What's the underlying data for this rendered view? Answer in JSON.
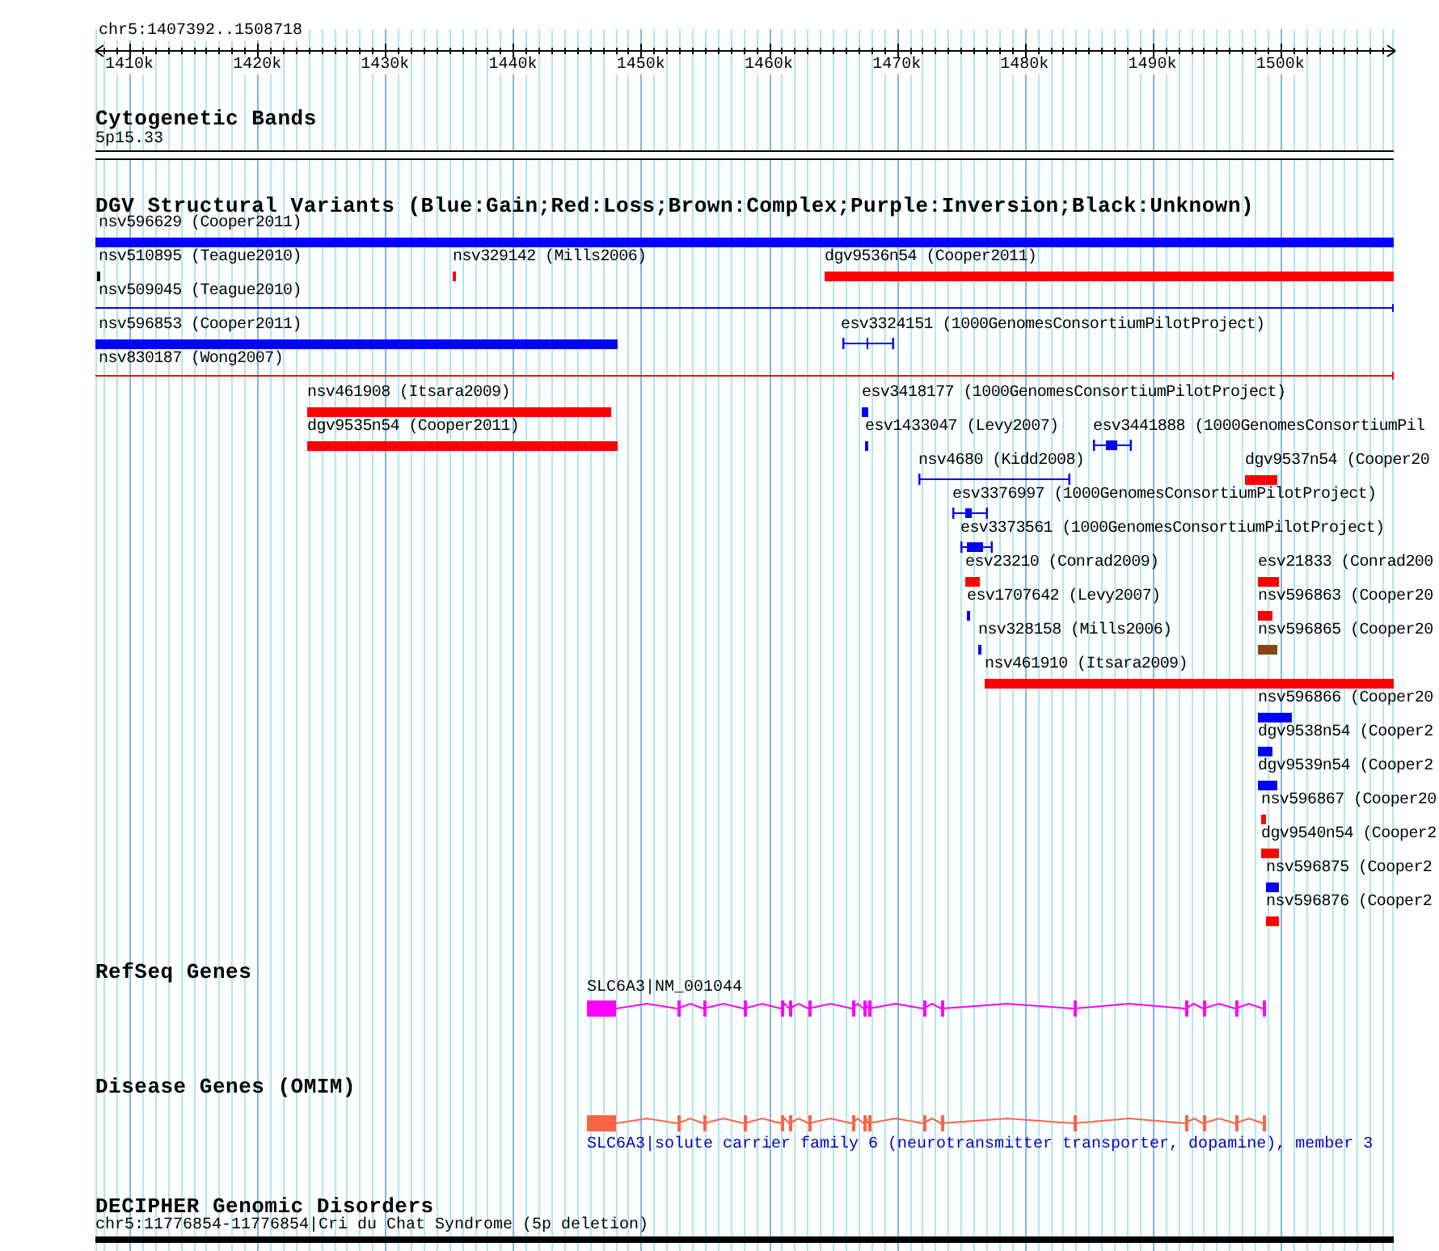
{
  "ruler": {
    "title": "chr5:1407392..1508718",
    "ticks": [
      "1410k",
      "1420k",
      "1430k",
      "1440k",
      "1450k",
      "1460k",
      "1470k",
      "1480k",
      "1490k",
      "1500k"
    ]
  },
  "tracks": [
    {
      "kind": "bands",
      "title": "Cytogenetic Bands",
      "features": [
        {
          "label": "5p15.33"
        }
      ]
    },
    {
      "kind": "variants",
      "title": "DGV Structural Variants (Blue:Gain;Red:Loss;Brown:Complex;Purple:Inversion;Black:Unknown)",
      "features": [
        {
          "kind": "bar",
          "label": "nsv596629 (Cooper2011)",
          "color": "#0000ff"
        },
        {
          "kind": "bar",
          "label": "nsv510895 (Teague2010)",
          "color": "#000000"
        },
        {
          "kind": "bar",
          "label": "nsv329142 (Mills2006)",
          "color": "#ff0000"
        },
        {
          "kind": "bar",
          "label": "dgv9536n54 (Cooper2011)",
          "color": "#ff0000"
        },
        {
          "kind": "line",
          "label": "nsv509045 (Teague2010)",
          "color": "#0000ff"
        },
        {
          "kind": "bar",
          "label": "nsv596853 (Cooper2011)",
          "color": "#0000ff"
        },
        {
          "kind": "span",
          "label": "esv3324151 (1000GenomesConsortiumPilotProject)",
          "color": "#0000ff"
        },
        {
          "kind": "line",
          "label": "nsv830187 (Wong2007)",
          "color": "#ff0000"
        },
        {
          "kind": "bar",
          "label": "nsv461908 (Itsara2009)",
          "color": "#ff0000"
        },
        {
          "kind": "bar",
          "label": "esv3418177 (1000GenomesConsortiumPilotProject)",
          "color": "#0000ff"
        },
        {
          "kind": "bar",
          "label": "dgv9535n54 (Cooper2011)",
          "color": "#ff0000"
        },
        {
          "kind": "bar",
          "label": "esv1433047 (Levy2007)",
          "color": "#0000ff"
        },
        {
          "kind": "span",
          "label": "esv3441888 (1000GenomesConsortiumPil",
          "color": "#0000ff"
        },
        {
          "kind": "span",
          "label": "nsv4680 (Kidd2008)",
          "color": "#0000ff"
        },
        {
          "kind": "bar",
          "label": "dgv9537n54 (Cooper20",
          "color": "#ff0000"
        },
        {
          "kind": "span",
          "label": "esv3376997 (1000GenomesConsortiumPilotProject)",
          "color": "#0000ff"
        },
        {
          "kind": "span",
          "label": "esv3373561 (1000GenomesConsortiumPilotProject)",
          "color": "#0000ff"
        },
        {
          "kind": "bar",
          "label": "esv23210 (Conrad2009)",
          "color": "#ff0000"
        },
        {
          "kind": "bar",
          "label": "esv21833 (Conrad200",
          "color": "#ff0000"
        },
        {
          "kind": "bar",
          "label": "esv1707642 (Levy2007)",
          "color": "#0000ff"
        },
        {
          "kind": "bar",
          "label": "nsv596863 (Cooper20",
          "color": "#ff0000"
        },
        {
          "kind": "bar",
          "label": "nsv328158 (Mills2006)",
          "color": "#0000ff"
        },
        {
          "kind": "bar",
          "label": "nsv596865 (Cooper20",
          "color": "#8b4513"
        },
        {
          "kind": "bar",
          "label": "nsv461910 (Itsara2009)",
          "color": "#ff0000"
        },
        {
          "kind": "bar",
          "label": "nsv596866 (Cooper20",
          "color": "#0000ff"
        },
        {
          "kind": "bar",
          "label": "dgv9538n54 (Cooper2",
          "color": "#0000ff"
        },
        {
          "kind": "bar",
          "label": "dgv9539n54 (Cooper2",
          "color": "#0000ff"
        },
        {
          "kind": "bar",
          "label": "nsv596867 (Cooper20",
          "color": "#ff0000"
        },
        {
          "kind": "bar",
          "label": "dgv9540n54 (Cooper2",
          "color": "#ff0000"
        },
        {
          "kind": "bar",
          "label": "nsv596875 (Cooper2",
          "color": "#0000ff"
        },
        {
          "kind": "bar",
          "label": "nsv596876 (Cooper2",
          "color": "#ff0000"
        }
      ]
    },
    {
      "kind": "genes",
      "title": "RefSeq Genes",
      "features": [
        {
          "label": "SLC6A3|NM_001044",
          "color": "#ff00ff"
        }
      ]
    },
    {
      "kind": "disease",
      "title": "Disease Genes (OMIM)",
      "features": [
        {
          "label": "SLC6A3|solute carrier family 6 (neurotransmitter transporter, dopamine), member 3",
          "color": "#ff6347"
        }
      ]
    },
    {
      "kind": "decipher",
      "title": "DECIPHER Genomic Disorders",
      "features": [
        {
          "label": "chr5:11776854-11776854|Cri du Chat Syndrome (5p deletion)"
        }
      ]
    }
  ]
}
